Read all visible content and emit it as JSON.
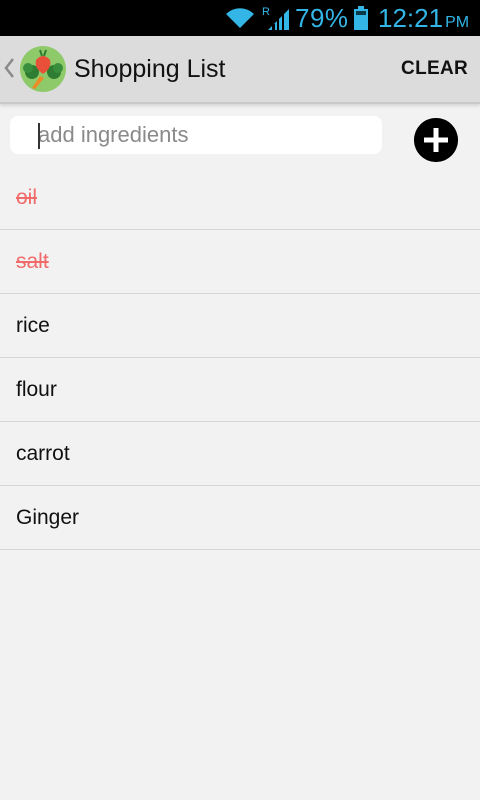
{
  "status_bar": {
    "wifi_icon": "wifi-icon",
    "signal_icon": "signal-roaming-icon",
    "signal_roaming_label": "R",
    "battery_percent": "79%",
    "battery_icon": "battery-icon",
    "time": "12:21",
    "ampm": "PM",
    "color": "#33b5e5"
  },
  "action_bar": {
    "up_icon": "chevron-left-icon",
    "app_icon": "vegetables-logo-icon",
    "title": "Shopping List",
    "clear_label": "CLEAR"
  },
  "input": {
    "placeholder": "add ingredients",
    "value": "",
    "add_icon": "plus-circle-icon"
  },
  "items": [
    {
      "label": "oil",
      "checked": true
    },
    {
      "label": "salt",
      "checked": true
    },
    {
      "label": "rice",
      "checked": false
    },
    {
      "label": "flour",
      "checked": false
    },
    {
      "label": "carrot",
      "checked": false
    },
    {
      "label": "Ginger",
      "checked": false
    }
  ],
  "colors": {
    "checked_text": "#f26b6b",
    "action_bar": "#dcdcdc",
    "background": "#f2f2f2"
  }
}
